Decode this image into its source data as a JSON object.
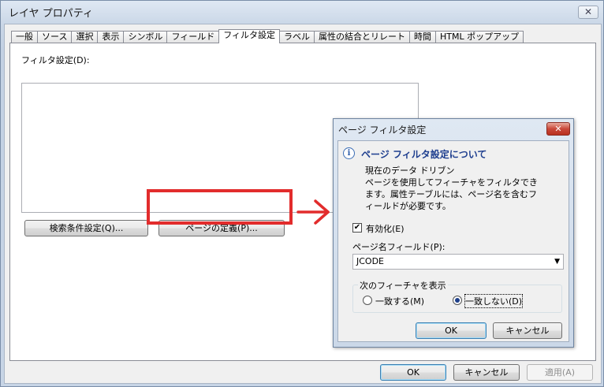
{
  "window": {
    "title": "レイヤ プロパティ",
    "close_glyph": "✕",
    "tabs": [
      "一般",
      "ソース",
      "選択",
      "表示",
      "シンボル",
      "フィールド",
      "フィルタ設定",
      "ラベル",
      "属性の結合とリレート",
      "時間",
      "HTML ポップアップ"
    ],
    "active_tab": "フィルタ設定",
    "filter_label": "フィルタ設定(D):",
    "buttons": {
      "query": "検索条件設定(Q)...",
      "page_def": "ページの定義(P)...",
      "ok": "OK",
      "cancel": "キャンセル",
      "apply": "適用(A)"
    },
    "highlight_color": "#e22c2c"
  },
  "page_dialog": {
    "title": "ページ フィルタ設定",
    "close_glyph": "✕",
    "info_heading": "ページ フィルタ設定について",
    "description_lines": [
      "現在のデータ ドリブン",
      "ページを使用してフィーチャをフィルタでき",
      "ます。属性テーブルには、ページ名を含むフ",
      "ィールドが必要です。"
    ],
    "enabled": {
      "label": "有効化(E)",
      "checked": true
    },
    "page_field_label": "ページ名フィールド(P):",
    "page_field_value": "JCODE",
    "show_group": {
      "label": "次のフィーチャを表示",
      "options": [
        {
          "label": "一致する(M)",
          "selected": false
        },
        {
          "label": "一致しない(D)",
          "selected": true
        }
      ]
    },
    "buttons": {
      "ok": "OK",
      "cancel": "キャンセル"
    }
  }
}
